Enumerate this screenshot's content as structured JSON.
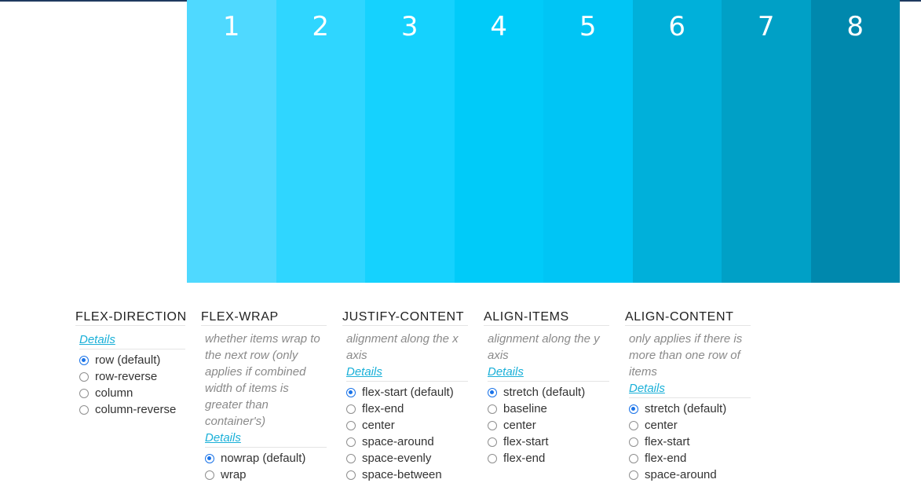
{
  "demo": {
    "items": [
      {
        "label": "1",
        "color": "#4fd9ff"
      },
      {
        "label": "2",
        "color": "#2fd6ff"
      },
      {
        "label": "3",
        "color": "#15d2fe"
      },
      {
        "label": "4",
        "color": "#00cbf9"
      },
      {
        "label": "5",
        "color": "#00c5f5"
      },
      {
        "label": "6",
        "color": "#00b0da"
      },
      {
        "label": "7",
        "color": "#00a0c6"
      },
      {
        "label": "8",
        "color": "#0088ad"
      }
    ]
  },
  "controls": {
    "flex_direction": {
      "title": "FLEX-DIRECTION",
      "details": "Details",
      "options": [
        {
          "label": "row (default)",
          "checked": true
        },
        {
          "label": "row-reverse",
          "checked": false
        },
        {
          "label": "column",
          "checked": false
        },
        {
          "label": "column-reverse",
          "checked": false
        }
      ]
    },
    "flex_wrap": {
      "title": "FLEX-WRAP",
      "description": "whether items wrap to the next row (only applies if combined width of items is greater than container's)",
      "details": "Details",
      "options": [
        {
          "label": "nowrap (default)",
          "checked": true
        },
        {
          "label": "wrap",
          "checked": false
        }
      ]
    },
    "justify_content": {
      "title": "JUSTIFY-CONTENT",
      "description": "alignment along the x axis",
      "details": "Details",
      "options": [
        {
          "label": "flex-start (default)",
          "checked": true
        },
        {
          "label": "flex-end",
          "checked": false
        },
        {
          "label": "center",
          "checked": false
        },
        {
          "label": "space-around",
          "checked": false
        },
        {
          "label": "space-evenly",
          "checked": false
        },
        {
          "label": "space-between",
          "checked": false
        }
      ]
    },
    "align_items": {
      "title": "ALIGN-ITEMS",
      "description": "alignment along the y axis",
      "details": "Details",
      "options": [
        {
          "label": "stretch (default)",
          "checked": true
        },
        {
          "label": "baseline",
          "checked": false
        },
        {
          "label": "center",
          "checked": false
        },
        {
          "label": "flex-start",
          "checked": false
        },
        {
          "label": "flex-end",
          "checked": false
        }
      ]
    },
    "align_content": {
      "title": "ALIGN-CONTENT",
      "description": "only applies if there is more than one row of items",
      "details": "Details",
      "options": [
        {
          "label": "stretch (default)",
          "checked": true
        },
        {
          "label": "center",
          "checked": false
        },
        {
          "label": "flex-start",
          "checked": false
        },
        {
          "label": "flex-end",
          "checked": false
        },
        {
          "label": "space-around",
          "checked": false
        }
      ]
    }
  }
}
